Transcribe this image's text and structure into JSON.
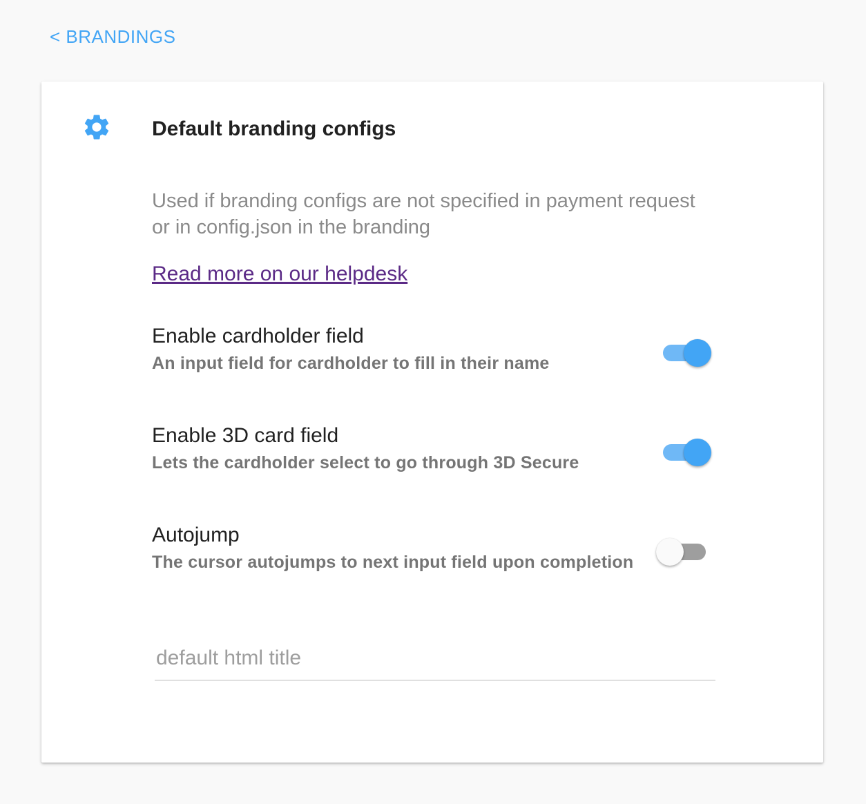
{
  "nav": {
    "back_label": "< BRANDINGS"
  },
  "card": {
    "title": "Default branding configs",
    "icon": "gear-icon",
    "description": "Used if branding configs are not specified in payment request or in config.json in the branding",
    "help_link": "Read more on our helpdesk"
  },
  "settings": [
    {
      "title": "Enable cardholder field",
      "description": "An input field for cardholder to fill in their name",
      "enabled": true
    },
    {
      "title": "Enable 3D card field",
      "description": "Lets the cardholder select to go through 3D Secure",
      "enabled": true
    },
    {
      "title": "Autojump",
      "description": "The cursor autojumps to next input field upon completion",
      "enabled": false
    }
  ],
  "html_title": {
    "value": "",
    "placeholder": "default html title"
  },
  "colors": {
    "accent": "#42a5f5",
    "link_visited": "#5b2a86"
  }
}
